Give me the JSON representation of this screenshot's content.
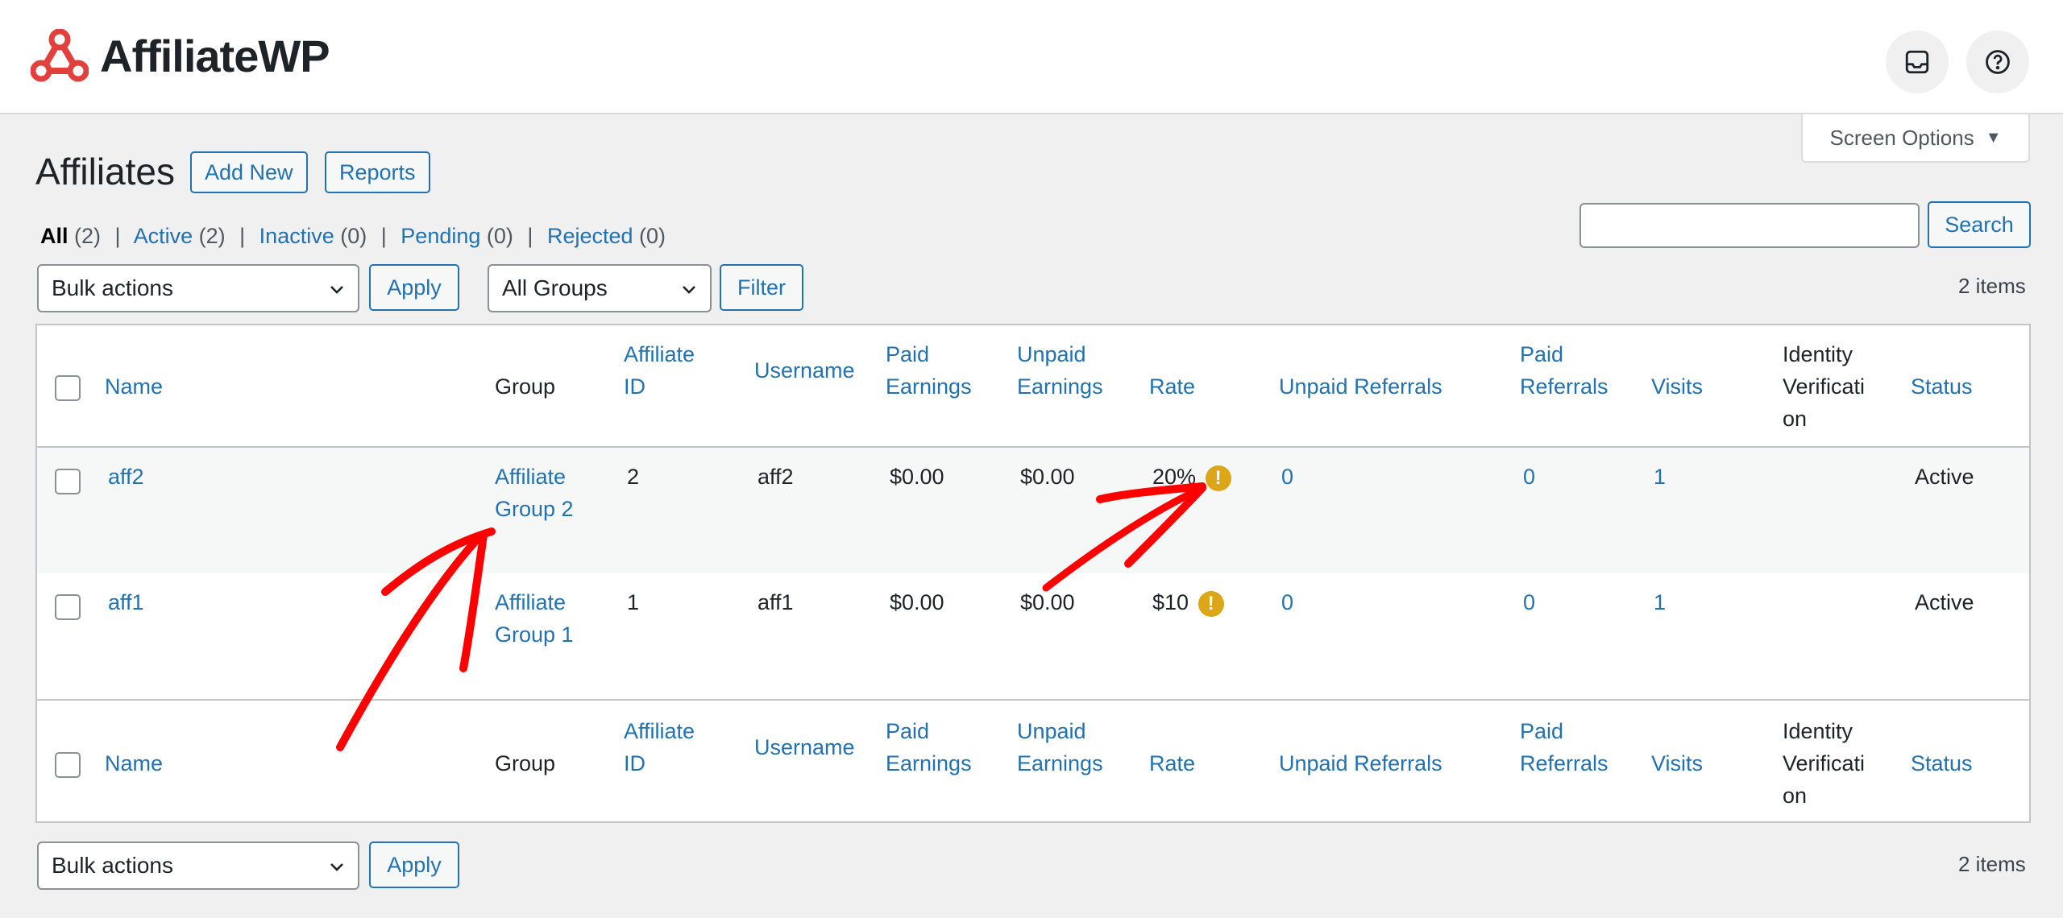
{
  "app": {
    "logo_text": "AffiliateWP",
    "accent": "#2271b1",
    "brand_color": "#e2403c"
  },
  "header": {
    "inbox_icon": "inbox-icon",
    "help_icon": "help-icon",
    "screen_options": "Screen Options"
  },
  "page": {
    "title": "Affiliates",
    "add_new": "Add New",
    "reports": "Reports"
  },
  "filters": {
    "views": [
      {
        "label": "All",
        "count": "(2)"
      },
      {
        "label": "Active",
        "count": "(2)"
      },
      {
        "label": "Inactive",
        "count": "(0)"
      },
      {
        "label": "Pending",
        "count": "(0)"
      },
      {
        "label": "Rejected",
        "count": "(0)"
      }
    ],
    "separator": "|",
    "search_value": "",
    "search_button": "Search",
    "bulk_actions": "Bulk actions",
    "apply": "Apply",
    "groups_select": "All Groups",
    "filter_button": "Filter",
    "items_count": "2 items"
  },
  "table": {
    "columns": {
      "name": "Name",
      "group": "Group",
      "affiliate_id_1": "Affiliate",
      "affiliate_id_2": "ID",
      "username": "Username",
      "paid_earnings_1": "Paid",
      "paid_earnings_2": "Earnings",
      "unpaid_earnings_1": "Unpaid",
      "unpaid_earnings_2": "Earnings",
      "rate": "Rate",
      "unpaid_referrals": "Unpaid Referrals",
      "paid_referrals_1": "Paid",
      "paid_referrals_2": "Referrals",
      "visits": "Visits",
      "identity_1": "Identity",
      "identity_2": "Verificati",
      "identity_3": "on",
      "status": "Status"
    },
    "rows": [
      {
        "name": "aff2",
        "group_1": "Affiliate",
        "group_2": "Group 2",
        "affiliate_id": "2",
        "username": "aff2",
        "paid_earnings": "$0.00",
        "unpaid_earnings": "$0.00",
        "rate": "20%",
        "rate_warning": "!",
        "unpaid_referrals": "0",
        "paid_referrals": "0",
        "visits": "1",
        "identity": "",
        "status": "Active"
      },
      {
        "name": "aff1",
        "group_1": "Affiliate",
        "group_2": "Group 1",
        "affiliate_id": "1",
        "username": "aff1",
        "paid_earnings": "$0.00",
        "unpaid_earnings": "$0.00",
        "rate": "$10",
        "rate_warning": "!",
        "unpaid_referrals": "0",
        "paid_referrals": "0",
        "visits": "1",
        "identity": "",
        "status": "Active"
      }
    ]
  },
  "annotations": {
    "arrow_color": "#ff0000",
    "arrow_icons": [
      "arrow-to-group-icon",
      "arrow-to-rate-icon"
    ]
  }
}
